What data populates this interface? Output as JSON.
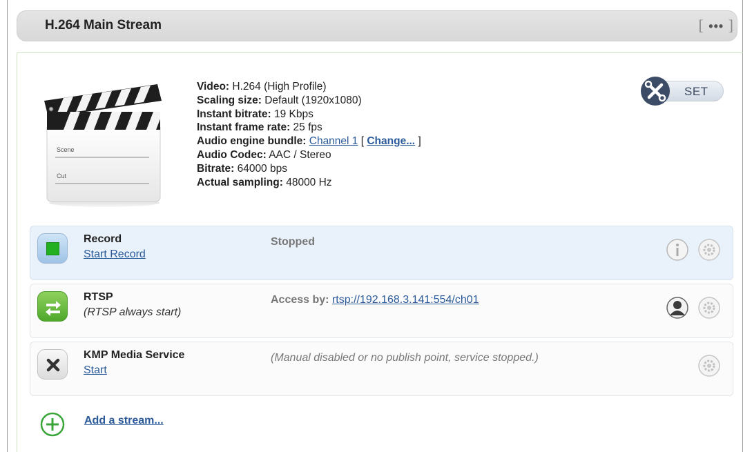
{
  "header": {
    "title": "H.264 Main Stream",
    "menu_open": "[",
    "menu_dots": "•••",
    "menu_close": "]"
  },
  "info": {
    "video_label": "Video:",
    "video_value": "H.264 (High Profile)",
    "scaling_label": "Scaling size:",
    "scaling_value": "Default (1920x1080)",
    "bitrate_label": "Instant bitrate:",
    "bitrate_value": "19 Kbps",
    "framerate_label": "Instant frame rate:",
    "framerate_value": "25 fps",
    "audio_bundle_label": "Audio engine bundle:",
    "audio_bundle_link": "Channel 1",
    "change_open": "[",
    "change_link": "Change...",
    "change_close": "]",
    "codec_label": "Audio Codec:",
    "codec_value": "AAC / Stereo",
    "audio_bitrate_label": "Bitrate:",
    "audio_bitrate_value": "64000 bps",
    "sampling_label": "Actual sampling:",
    "sampling_value": "48000 Hz"
  },
  "clapper": {
    "scene_label": "Scene",
    "cut_label": "Cut"
  },
  "set_button": {
    "label": "SET"
  },
  "rows": [
    {
      "name": "Record",
      "sub": "Start Record",
      "status": "Stopped",
      "icon": "record-stop-icon"
    },
    {
      "name": "RTSP",
      "sub": "(RTSP always start)",
      "status_label": "Access by:",
      "status_link": "rtsp://192.168.3.141:554/ch01",
      "icon": "rtsp-arrows-icon"
    },
    {
      "name": "KMP Media Service",
      "sub": "Start",
      "status": "(Manual disabled or no publish point, service stopped.)",
      "icon": "kmp-x-icon"
    }
  ],
  "add_stream": {
    "label": "Add a stream..."
  },
  "colors": {
    "link": "#2a5a9a",
    "record_green": "#22b020",
    "rtsp_green": "#5fb83a",
    "set_dark": "#3c4c66"
  }
}
